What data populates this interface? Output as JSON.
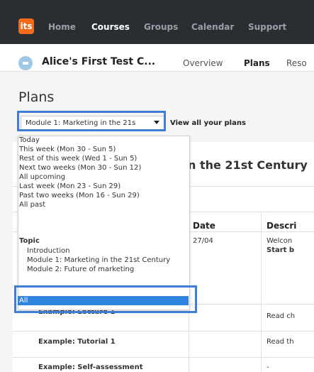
{
  "app": {
    "logo_text": "its",
    "nav": [
      {
        "label": "Home",
        "active": false
      },
      {
        "label": "Courses",
        "active": true
      },
      {
        "label": "Groups",
        "active": false
      },
      {
        "label": "Calendar",
        "active": false
      },
      {
        "label": "Support",
        "active": false
      }
    ]
  },
  "course": {
    "title": "Alice's First Test C...",
    "tabs": [
      {
        "label": "Overview",
        "active": false
      },
      {
        "label": "Plans",
        "active": true
      },
      {
        "label": "Reso",
        "active": false
      }
    ]
  },
  "page": {
    "heading": "Plans",
    "select_value": "Module 1: Marketing in the 21s",
    "view_all_label": "View all your plans"
  },
  "plan_card": {
    "title_partial": "n the 21st Century",
    "columns": [
      "Date",
      "Descri"
    ],
    "rows": [
      {
        "name": "",
        "date": "27/04",
        "desc_line1": "Welcon",
        "desc_line2": "Start b"
      },
      {
        "name": "Example: Lecture 1",
        "date": "",
        "desc_line1": "Read ch",
        "desc_line2": ""
      },
      {
        "name": "Example: Tutorial 1",
        "date": "",
        "desc_line1": "Read th",
        "desc_line2": ""
      },
      {
        "name": "Example: Self-assessment",
        "date": "",
        "desc_line1": "-",
        "desc_line2": ""
      }
    ]
  },
  "dropdown": {
    "options": [
      "Today",
      "This week (Mon 30 - Sun 5)",
      "Rest of this week (Wed 1 - Sun 5)",
      "Next two weeks (Mon 30 - Sun 12)",
      "All upcoming",
      "Last week (Mon 23 - Sun 29)",
      "Past two weeks (Mon 16 - Sun 29)",
      "All past"
    ],
    "group_label": "Topic",
    "topic_options": [
      "Introduction",
      "Module 1: Marketing in the 21st Century",
      "Module 2: Future of marketing"
    ],
    "selected": "All"
  },
  "colors": {
    "nav_bg": "#2a2e33",
    "logo": "#f26a1b",
    "highlight_border": "#3f7dd6",
    "selected_option": "#2f84e0"
  }
}
